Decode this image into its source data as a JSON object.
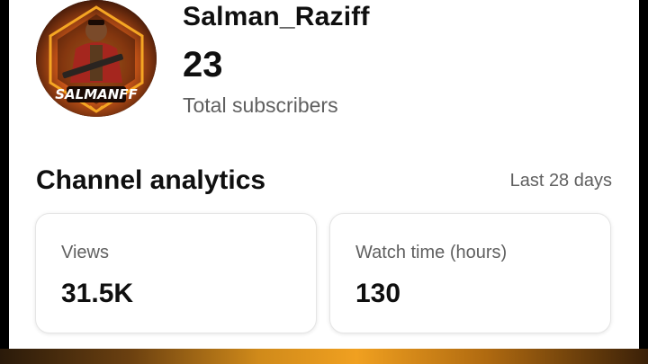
{
  "channel": {
    "name": "Salman_Raziff",
    "subscriber_count": "23",
    "subscriber_label": "Total subscribers",
    "avatar_text": "SALMANFF"
  },
  "analytics": {
    "title": "Channel analytics",
    "period": "Last 28 days",
    "cards": [
      {
        "label": "Views",
        "value": "31.5K"
      },
      {
        "label": "Watch time (hours)",
        "value": "130"
      }
    ]
  },
  "colors": {
    "primary_text": "#0f0f0f",
    "secondary_text": "#606060",
    "card_border": "#e5e5e5"
  }
}
